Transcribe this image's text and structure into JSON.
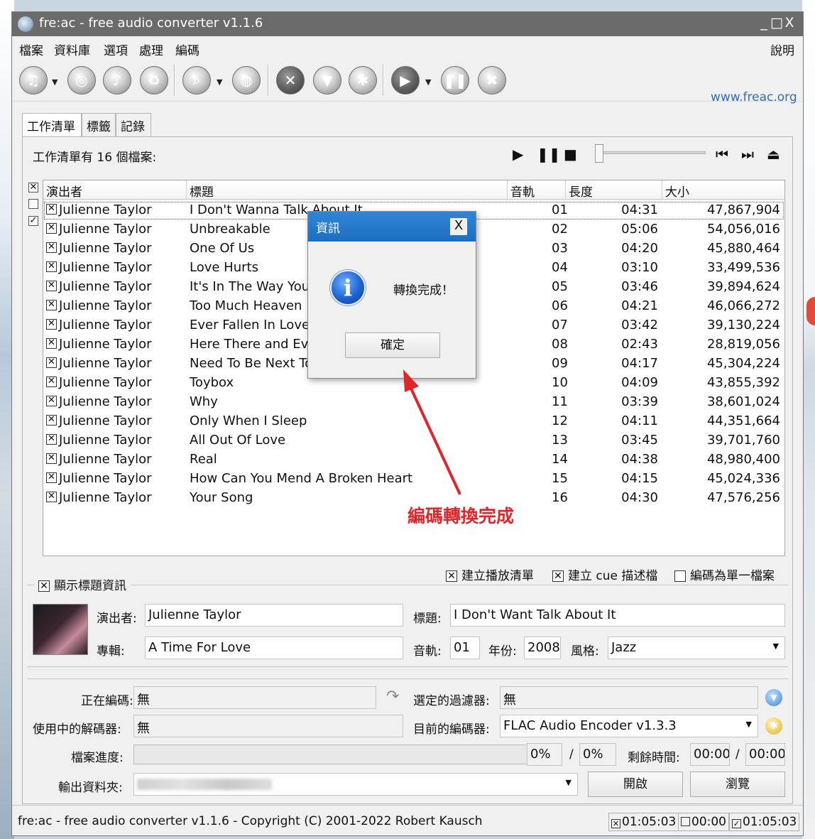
{
  "window": {
    "title": "fre:ac - free audio converter v1.1.6",
    "controls": {
      "minimize": "_",
      "maximize": "□",
      "close": "X"
    }
  },
  "menu": {
    "items": [
      "檔案",
      "資料庫",
      "選項",
      "處理",
      "編碼"
    ],
    "help": "說明"
  },
  "toolbar": {
    "website": "www.freac.org"
  },
  "tabs": [
    "工作清單",
    "標籤",
    "記錄"
  ],
  "joblist": {
    "count_text": "工作清單有 16 個檔案:",
    "headers": {
      "artist": "演出者",
      "title": "標題",
      "track": "音軌",
      "length": "長度",
      "size": "大小"
    },
    "rows": [
      {
        "check": "☒",
        "artist": "Julienne Taylor",
        "title": "I Don't Wanna Talk About It",
        "track": "01",
        "length": "04:31",
        "size": "47,867,904"
      },
      {
        "check": "☒",
        "artist": "Julienne Taylor",
        "title": "Unbreakable",
        "track": "02",
        "length": "05:06",
        "size": "54,056,016"
      },
      {
        "check": "☒",
        "artist": "Julienne Taylor",
        "title": "One Of Us",
        "track": "03",
        "length": "04:20",
        "size": "45,880,464"
      },
      {
        "check": "☒",
        "artist": "Julienne Taylor",
        "title": "Love Hurts",
        "track": "04",
        "length": "03:10",
        "size": "33,499,536"
      },
      {
        "check": "☒",
        "artist": "Julienne Taylor",
        "title": "It's In The Way You",
        "track": "05",
        "length": "03:46",
        "size": "39,894,624"
      },
      {
        "check": "☒",
        "artist": "Julienne Taylor",
        "title": "Too Much Heaven",
        "track": "06",
        "length": "04:21",
        "size": "46,066,272"
      },
      {
        "check": "☒",
        "artist": "Julienne Taylor",
        "title": "Ever Fallen In Love",
        "track": "07",
        "length": "03:42",
        "size": "39,130,224"
      },
      {
        "check": "☒",
        "artist": "Julienne Taylor",
        "title": "Here There and Eve",
        "track": "08",
        "length": "02:43",
        "size": "28,819,056"
      },
      {
        "check": "☒",
        "artist": "Julienne Taylor",
        "title": "Need To Be Next To",
        "track": "09",
        "length": "04:17",
        "size": "45,304,224"
      },
      {
        "check": "☒",
        "artist": "Julienne Taylor",
        "title": "Toybox",
        "track": "10",
        "length": "04:09",
        "size": "43,855,392"
      },
      {
        "check": "☒",
        "artist": "Julienne Taylor",
        "title": "Why",
        "track": "11",
        "length": "03:39",
        "size": "38,601,024"
      },
      {
        "check": "☒",
        "artist": "Julienne Taylor",
        "title": "Only When I Sleep",
        "track": "12",
        "length": "04:11",
        "size": "44,351,664"
      },
      {
        "check": "☒",
        "artist": "Julienne Taylor",
        "title": "All Out Of Love",
        "track": "13",
        "length": "03:45",
        "size": "39,701,760"
      },
      {
        "check": "☒",
        "artist": "Julienne Taylor",
        "title": "Real",
        "track": "14",
        "length": "04:38",
        "size": "48,980,400"
      },
      {
        "check": "☒",
        "artist": "Julienne Taylor",
        "title": "How Can You Mend A Broken Heart",
        "track": "15",
        "length": "04:15",
        "size": "45,024,336"
      },
      {
        "check": "☒",
        "artist": "Julienne Taylor",
        "title": "Your Song",
        "track": "16",
        "length": "04:30",
        "size": "47,576,256"
      }
    ],
    "options": {
      "playlist": "建立播放清單",
      "cue": "建立 cue 描述檔",
      "single_file": "編碼為單一檔案"
    }
  },
  "taginfo": {
    "legend": "顯示標題資訊",
    "artist_label": "演出者:",
    "artist": "Julienne Taylor",
    "title_label": "標題:",
    "title": "I Don't Want Talk About It",
    "album_label": "專輯:",
    "album": "A Time For Love",
    "track_label": "音軌:",
    "track": "01",
    "year_label": "年份:",
    "year": "2008",
    "genre_label": "風格:",
    "genre": "Jazz"
  },
  "status": {
    "encoding_label": "正在編碼:",
    "encoding": "無",
    "filter_label": "選定的過濾器:",
    "filter": "無",
    "decoder_label": "使用中的解碼器:",
    "decoder": "無",
    "encoder_label": "目前的編碼器:",
    "encoder": "FLAC Audio Encoder v1.3.3",
    "progress_label": "檔案進度:",
    "file_progress": "0%",
    "sep": "/",
    "total_progress": "0%",
    "remaining_label": "剩餘時間:",
    "remaining": "00:00",
    "remaining_total": "00:00",
    "output_label": "輸出資料夾:",
    "open_button": "開啟",
    "browse_button": "瀏覽"
  },
  "statusbar": {
    "text": "fre:ac - free audio converter v1.1.6 - Copyright (C) 2001-2022 Robert Kausch",
    "total": "01:05:03",
    "unselected": "00:00",
    "selected": "01:05:03"
  },
  "dialog": {
    "title": "資訊",
    "message": "轉換完成！",
    "ok": "確定",
    "close": "X"
  },
  "annotation": {
    "text": "編碼轉換完成",
    "color": "#e0262b"
  }
}
